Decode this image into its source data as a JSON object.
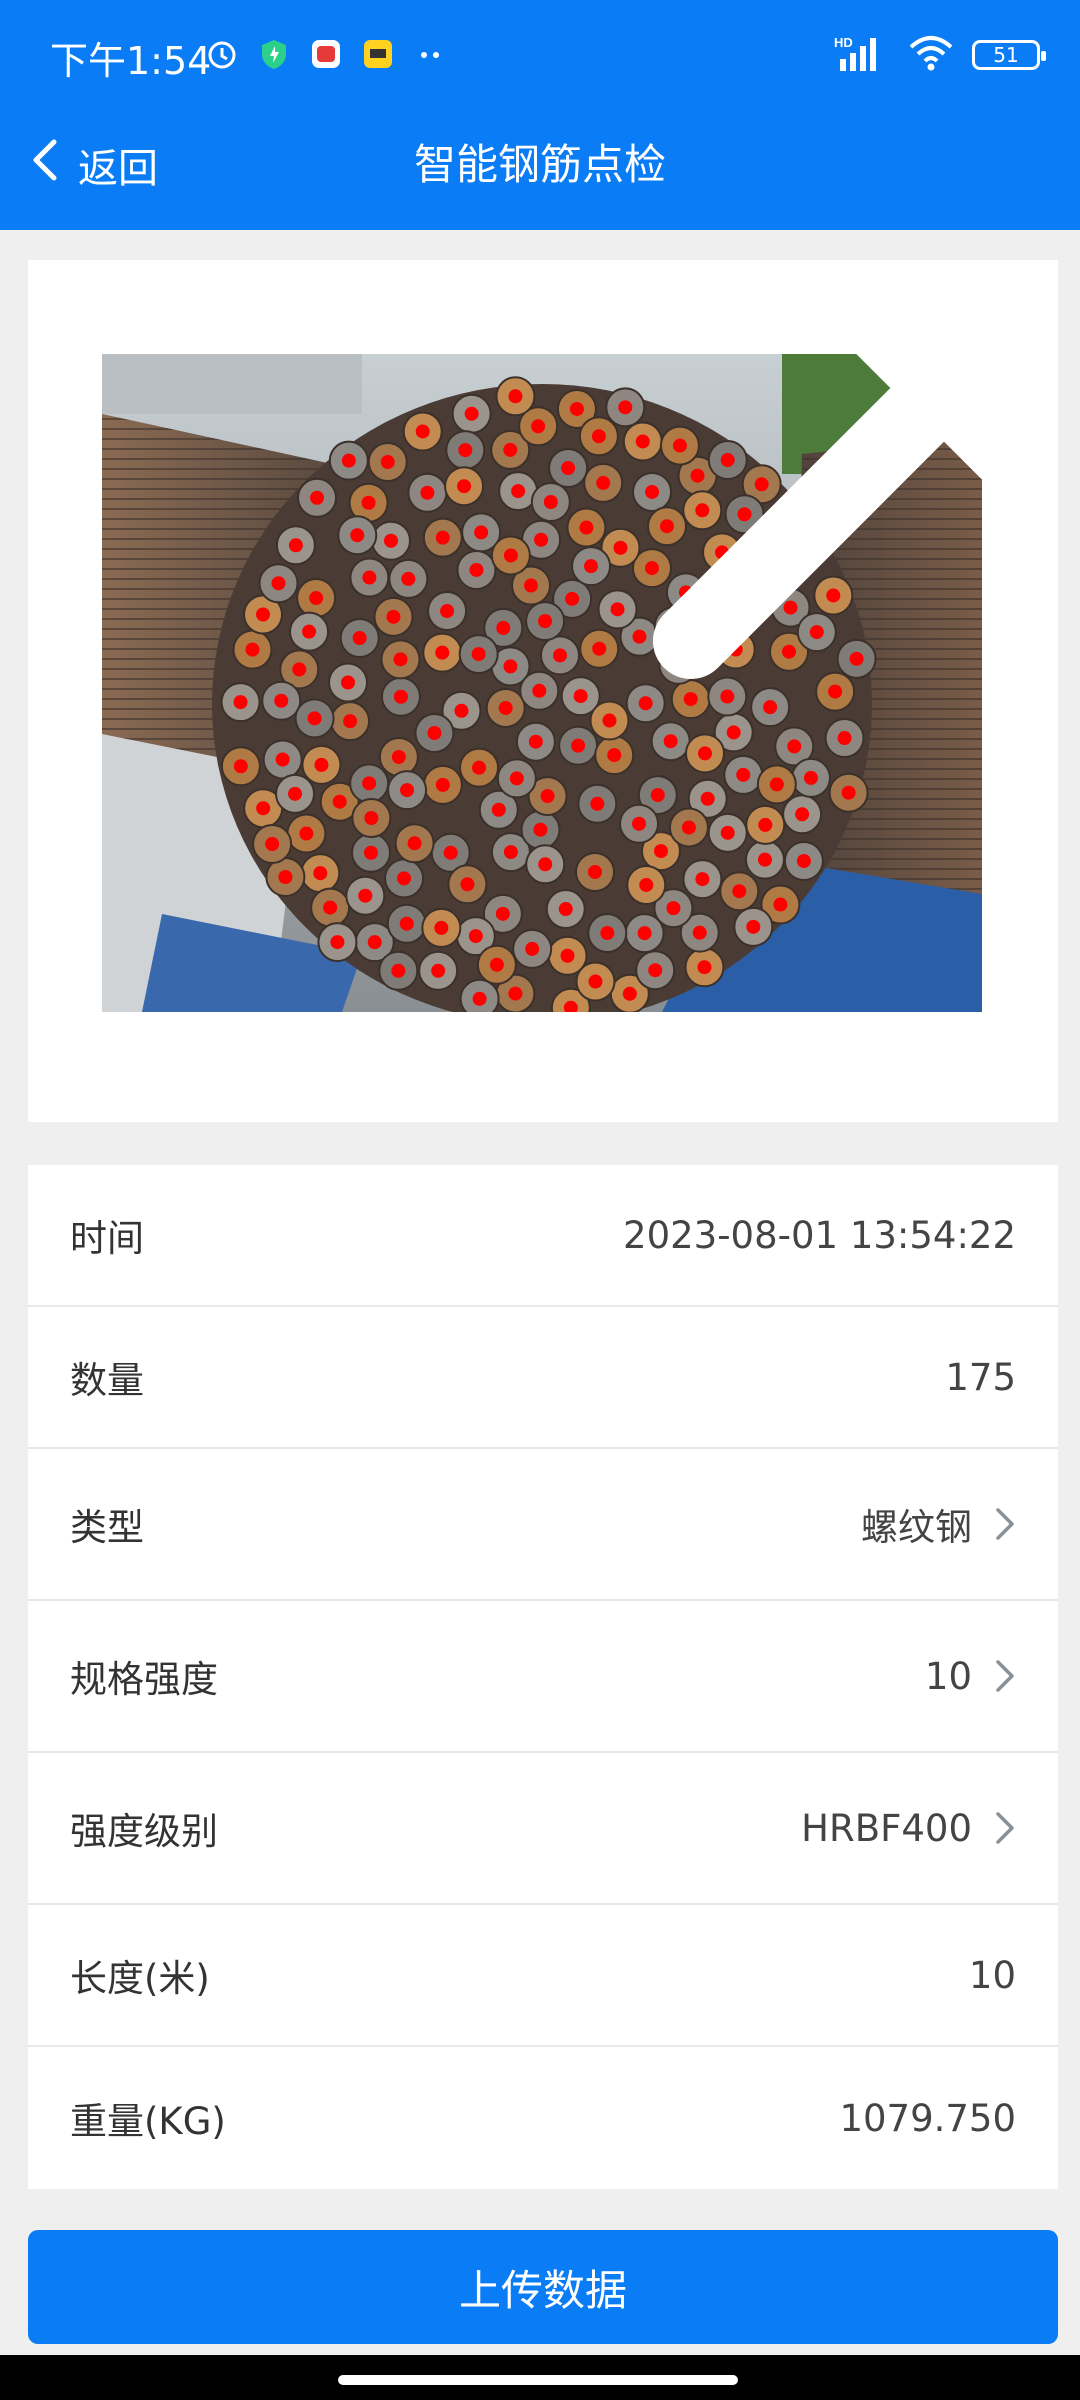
{
  "status_bar": {
    "time": "下午1:54",
    "battery": "51",
    "network_label": "HD"
  },
  "nav": {
    "back_label": "返回",
    "title": "智能钢筋点检"
  },
  "photo": {
    "description_icon": "rebar-photo",
    "close_icon": "close-icon"
  },
  "details": [
    {
      "label": "时间",
      "value": "2023-08-01 13:54:22",
      "has_chevron": false
    },
    {
      "label": "数量",
      "value": "175",
      "has_chevron": false
    },
    {
      "label": "类型",
      "value": "螺纹钢",
      "has_chevron": true
    },
    {
      "label": "规格强度",
      "value": "10",
      "has_chevron": true
    },
    {
      "label": "强度级别",
      "value": "HRBF400",
      "has_chevron": true
    },
    {
      "label": "长度(米)",
      "value": "10",
      "has_chevron": false
    },
    {
      "label": "重量(KG)",
      "value": "1079.750",
      "has_chevron": false
    }
  ],
  "upload_button": "上传数据",
  "colors": {
    "primary": "#0a7cf5",
    "close_red": "#e5443d",
    "marker_red": "#ff0000"
  }
}
